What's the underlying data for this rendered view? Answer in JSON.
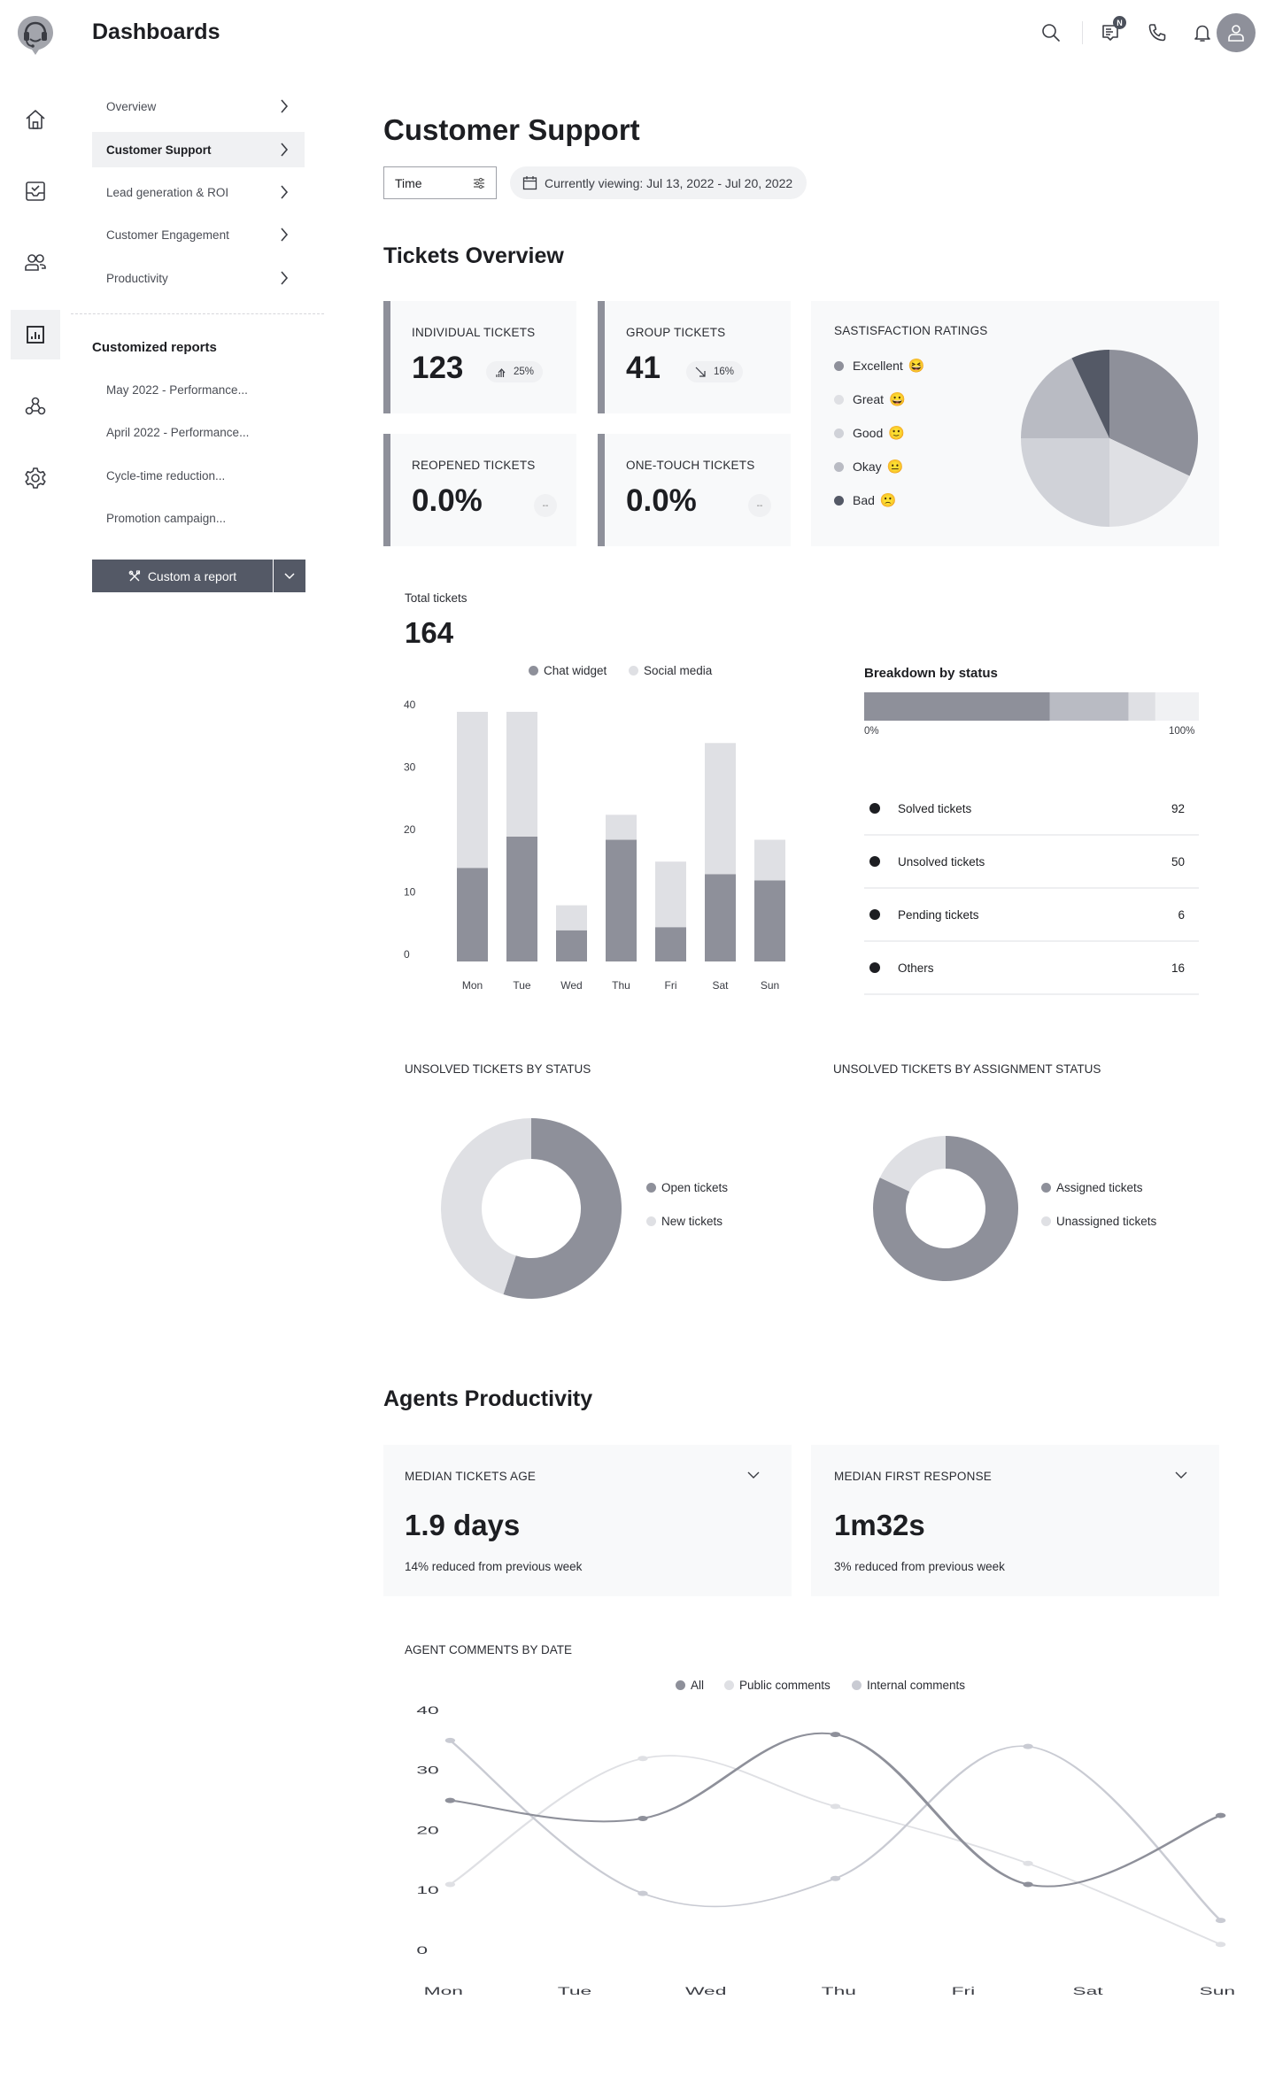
{
  "app": {
    "title": "Dashboards"
  },
  "topbar": {
    "icons": [
      "search-icon",
      "messages-icon",
      "phone-icon",
      "bell-icon",
      "user-avatar"
    ],
    "messages_badge": "N"
  },
  "rail": {
    "items": [
      {
        "icon": "home-icon",
        "active": false
      },
      {
        "icon": "inbox-check-icon",
        "active": false
      },
      {
        "icon": "users-icon",
        "active": false
      },
      {
        "icon": "report-chart-icon",
        "active": true
      },
      {
        "icon": "integrations-icon",
        "active": false
      },
      {
        "icon": "settings-icon",
        "active": false
      }
    ]
  },
  "sidebar": {
    "items": [
      {
        "label": "Overview",
        "active": false
      },
      {
        "label": "Customer Support",
        "active": true
      },
      {
        "label": "Lead generation & ROI",
        "active": false
      },
      {
        "label": "Customer Engagement",
        "active": false
      },
      {
        "label": "Productivity",
        "active": false
      }
    ],
    "customized_title": "Customized reports",
    "reports": [
      "May 2022 - Performance...",
      "April 2022 - Performance...",
      "Cycle-time reduction...",
      "Promotion campaign..."
    ],
    "custom_button": "Custom a report"
  },
  "main": {
    "title": "Customer Support",
    "time_filter": "Time",
    "date_range": "Currently viewing: Jul 13, 2022 - Jul 20, 2022",
    "tickets_overview": {
      "title": "Tickets Overview",
      "stats": [
        {
          "label": "Individual tickets",
          "value": "123",
          "trend": "25%",
          "trend_dir": "up"
        },
        {
          "label": "Group tickets",
          "value": "41",
          "trend": "16%",
          "trend_dir": "down"
        },
        {
          "label": "Reopened tickets",
          "value": "0.0%",
          "trend": "--",
          "trend_dir": "none"
        },
        {
          "label": "One-touch tickets",
          "value": "0.0%",
          "trend": "--",
          "trend_dir": "none"
        }
      ]
    },
    "total_tickets": {
      "label": "Total tickets",
      "value": "164"
    },
    "breakdown": {
      "title": "Breakdown by status",
      "min_label": "0%",
      "max_label": "100%",
      "rows": [
        {
          "label": "Solved tickets",
          "value": "92"
        },
        {
          "label": "Unsolved tickets",
          "value": "50"
        },
        {
          "label": "Pending tickets",
          "value": "6"
        },
        {
          "label": "Others",
          "value": "16"
        }
      ]
    },
    "agents": {
      "title": "Agents Productivity",
      "metrics": [
        {
          "label": "Median tickets age",
          "value": "1.9 days",
          "note": "14% reduced from previous week"
        },
        {
          "label": "Median first response",
          "value": "1m32s",
          "note": "3% reduced from previous week"
        }
      ]
    }
  },
  "colors": {
    "dark": "#545966",
    "mid": "#8e909a",
    "light": "#b9bbc3",
    "lighter": "#d0d2d8",
    "lightest": "#dfe0e4",
    "faint": "#f0f1f3"
  },
  "chart_data": [
    {
      "type": "pie",
      "title": "SASTISFACTION RATINGS",
      "categories": [
        "Excellent",
        "Great",
        "Good",
        "Okay",
        "Bad"
      ],
      "emojis": [
        "😆",
        "😀",
        "🙂",
        "😐",
        "🙁"
      ],
      "values": [
        32,
        18,
        25,
        18,
        7
      ],
      "colors": [
        "#8e909a",
        "#dfe0e4",
        "#d0d2d8",
        "#b9bbc3",
        "#545966"
      ],
      "legend": "left"
    },
    {
      "type": "bar",
      "stacked": true,
      "title": "TOTAL TICKETS",
      "categories": [
        "Mon",
        "Tue",
        "Wed",
        "Thu",
        "Fri",
        "Sat",
        "Sun"
      ],
      "series": [
        {
          "name": "Chat widget",
          "color": "#8e909a",
          "values": [
            15,
            20,
            5,
            19.5,
            5.5,
            14,
            13
          ]
        },
        {
          "name": "Social media",
          "color": "#dfe0e4",
          "values": [
            25,
            20,
            4,
            4,
            10.5,
            21,
            6.5
          ]
        }
      ],
      "yticks": [
        0,
        10,
        20,
        30,
        40
      ],
      "ylim": [
        0,
        40
      ],
      "legend": "top-center"
    },
    {
      "type": "bar",
      "stacked": true,
      "orientation": "horizontal",
      "title": "Breakdown by status",
      "categories": [
        "Solved tickets",
        "Unsolved tickets",
        "Pending tickets",
        "Others"
      ],
      "values": [
        55.5,
        23.5,
        8,
        13
      ],
      "colors": [
        "#8e909a",
        "#b9bbc3",
        "#dfe0e4",
        "#f0f1f3"
      ],
      "xlim": [
        0,
        100
      ],
      "xlabel_min": "0%",
      "xlabel_max": "100%"
    },
    {
      "type": "pie",
      "donut": true,
      "title": "UNSOLVED TICKETS BY STATUS",
      "categories": [
        "Open tickets",
        "New tickets"
      ],
      "values": [
        55,
        45
      ],
      "colors": [
        "#8e909a",
        "#dfe0e4"
      ],
      "legend": "right"
    },
    {
      "type": "pie",
      "donut": true,
      "title": "UNSOLVED TICKETS BY ASSIGNMENT STATUS",
      "categories": [
        "Assigned tickets",
        "Unassigned tickets"
      ],
      "values": [
        82,
        18
      ],
      "colors": [
        "#8e909a",
        "#dfe0e4"
      ],
      "legend": "right"
    },
    {
      "type": "line",
      "smooth": true,
      "title": "AGENT COMMENTS BY DATE",
      "xticks": [
        "Mon",
        "Tue",
        "Wed",
        "Thu",
        "Fri",
        "Sat",
        "Sun"
      ],
      "x": [
        0,
        1.5,
        3,
        4.5,
        6
      ],
      "series": [
        {
          "name": "All",
          "color": "#8e909a",
          "values": [
            25,
            22,
            36,
            11,
            22.5
          ]
        },
        {
          "name": "Public comments",
          "color": "#dfe0e4",
          "values": [
            11,
            32,
            24,
            14.5,
            1
          ]
        },
        {
          "name": "Internal comments",
          "color": "#c9cbd3",
          "values": [
            35,
            9.5,
            12,
            34,
            5
          ]
        }
      ],
      "yticks": [
        0,
        10,
        20,
        30,
        40
      ],
      "ylim": [
        0,
        40
      ],
      "legend": "top-center"
    }
  ]
}
